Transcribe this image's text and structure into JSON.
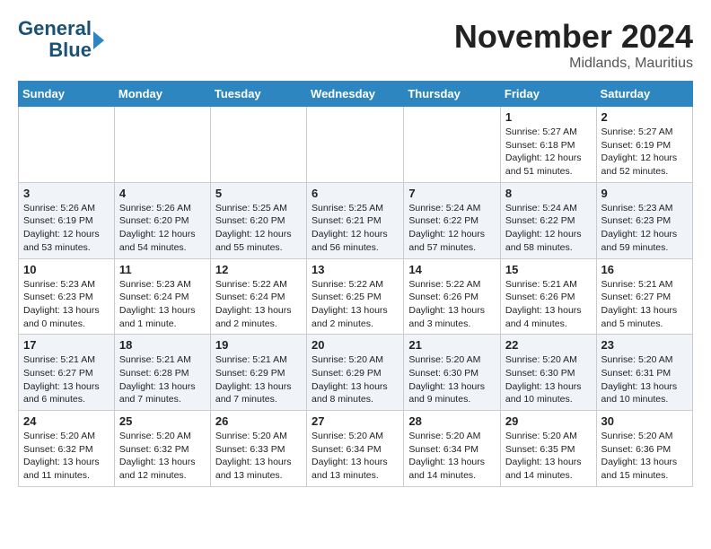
{
  "logo": {
    "line1": "General",
    "line2": "Blue"
  },
  "header": {
    "month": "November 2024",
    "location": "Midlands, Mauritius"
  },
  "weekdays": [
    "Sunday",
    "Monday",
    "Tuesday",
    "Wednesday",
    "Thursday",
    "Friday",
    "Saturday"
  ],
  "weeks": [
    [
      {
        "day": "",
        "info": ""
      },
      {
        "day": "",
        "info": ""
      },
      {
        "day": "",
        "info": ""
      },
      {
        "day": "",
        "info": ""
      },
      {
        "day": "",
        "info": ""
      },
      {
        "day": "1",
        "info": "Sunrise: 5:27 AM\nSunset: 6:18 PM\nDaylight: 12 hours and 51 minutes."
      },
      {
        "day": "2",
        "info": "Sunrise: 5:27 AM\nSunset: 6:19 PM\nDaylight: 12 hours and 52 minutes."
      }
    ],
    [
      {
        "day": "3",
        "info": "Sunrise: 5:26 AM\nSunset: 6:19 PM\nDaylight: 12 hours and 53 minutes."
      },
      {
        "day": "4",
        "info": "Sunrise: 5:26 AM\nSunset: 6:20 PM\nDaylight: 12 hours and 54 minutes."
      },
      {
        "day": "5",
        "info": "Sunrise: 5:25 AM\nSunset: 6:20 PM\nDaylight: 12 hours and 55 minutes."
      },
      {
        "day": "6",
        "info": "Sunrise: 5:25 AM\nSunset: 6:21 PM\nDaylight: 12 hours and 56 minutes."
      },
      {
        "day": "7",
        "info": "Sunrise: 5:24 AM\nSunset: 6:22 PM\nDaylight: 12 hours and 57 minutes."
      },
      {
        "day": "8",
        "info": "Sunrise: 5:24 AM\nSunset: 6:22 PM\nDaylight: 12 hours and 58 minutes."
      },
      {
        "day": "9",
        "info": "Sunrise: 5:23 AM\nSunset: 6:23 PM\nDaylight: 12 hours and 59 minutes."
      }
    ],
    [
      {
        "day": "10",
        "info": "Sunrise: 5:23 AM\nSunset: 6:23 PM\nDaylight: 13 hours and 0 minutes."
      },
      {
        "day": "11",
        "info": "Sunrise: 5:23 AM\nSunset: 6:24 PM\nDaylight: 13 hours and 1 minute."
      },
      {
        "day": "12",
        "info": "Sunrise: 5:22 AM\nSunset: 6:24 PM\nDaylight: 13 hours and 2 minutes."
      },
      {
        "day": "13",
        "info": "Sunrise: 5:22 AM\nSunset: 6:25 PM\nDaylight: 13 hours and 2 minutes."
      },
      {
        "day": "14",
        "info": "Sunrise: 5:22 AM\nSunset: 6:26 PM\nDaylight: 13 hours and 3 minutes."
      },
      {
        "day": "15",
        "info": "Sunrise: 5:21 AM\nSunset: 6:26 PM\nDaylight: 13 hours and 4 minutes."
      },
      {
        "day": "16",
        "info": "Sunrise: 5:21 AM\nSunset: 6:27 PM\nDaylight: 13 hours and 5 minutes."
      }
    ],
    [
      {
        "day": "17",
        "info": "Sunrise: 5:21 AM\nSunset: 6:27 PM\nDaylight: 13 hours and 6 minutes."
      },
      {
        "day": "18",
        "info": "Sunrise: 5:21 AM\nSunset: 6:28 PM\nDaylight: 13 hours and 7 minutes."
      },
      {
        "day": "19",
        "info": "Sunrise: 5:21 AM\nSunset: 6:29 PM\nDaylight: 13 hours and 7 minutes."
      },
      {
        "day": "20",
        "info": "Sunrise: 5:20 AM\nSunset: 6:29 PM\nDaylight: 13 hours and 8 minutes."
      },
      {
        "day": "21",
        "info": "Sunrise: 5:20 AM\nSunset: 6:30 PM\nDaylight: 13 hours and 9 minutes."
      },
      {
        "day": "22",
        "info": "Sunrise: 5:20 AM\nSunset: 6:30 PM\nDaylight: 13 hours and 10 minutes."
      },
      {
        "day": "23",
        "info": "Sunrise: 5:20 AM\nSunset: 6:31 PM\nDaylight: 13 hours and 10 minutes."
      }
    ],
    [
      {
        "day": "24",
        "info": "Sunrise: 5:20 AM\nSunset: 6:32 PM\nDaylight: 13 hours and 11 minutes."
      },
      {
        "day": "25",
        "info": "Sunrise: 5:20 AM\nSunset: 6:32 PM\nDaylight: 13 hours and 12 minutes."
      },
      {
        "day": "26",
        "info": "Sunrise: 5:20 AM\nSunset: 6:33 PM\nDaylight: 13 hours and 13 minutes."
      },
      {
        "day": "27",
        "info": "Sunrise: 5:20 AM\nSunset: 6:34 PM\nDaylight: 13 hours and 13 minutes."
      },
      {
        "day": "28",
        "info": "Sunrise: 5:20 AM\nSunset: 6:34 PM\nDaylight: 13 hours and 14 minutes."
      },
      {
        "day": "29",
        "info": "Sunrise: 5:20 AM\nSunset: 6:35 PM\nDaylight: 13 hours and 14 minutes."
      },
      {
        "day": "30",
        "info": "Sunrise: 5:20 AM\nSunset: 6:36 PM\nDaylight: 13 hours and 15 minutes."
      }
    ]
  ]
}
